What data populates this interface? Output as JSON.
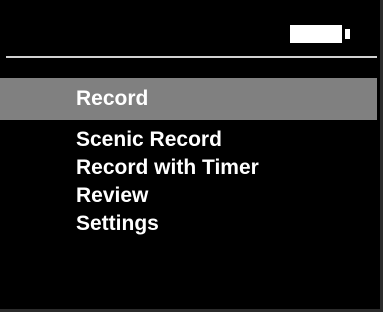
{
  "status_bar": {
    "battery_icon": "battery-full-icon",
    "battery_level": 1.0
  },
  "menu": {
    "selected_index": 0,
    "items": [
      {
        "label": "Record"
      },
      {
        "label": "Scenic Record"
      },
      {
        "label": "Record with Timer"
      },
      {
        "label": "Review"
      },
      {
        "label": "Settings"
      }
    ]
  },
  "colors": {
    "background": "#000000",
    "text": "#ffffff",
    "selection": "#808080",
    "divider": "#d0d0d0"
  }
}
